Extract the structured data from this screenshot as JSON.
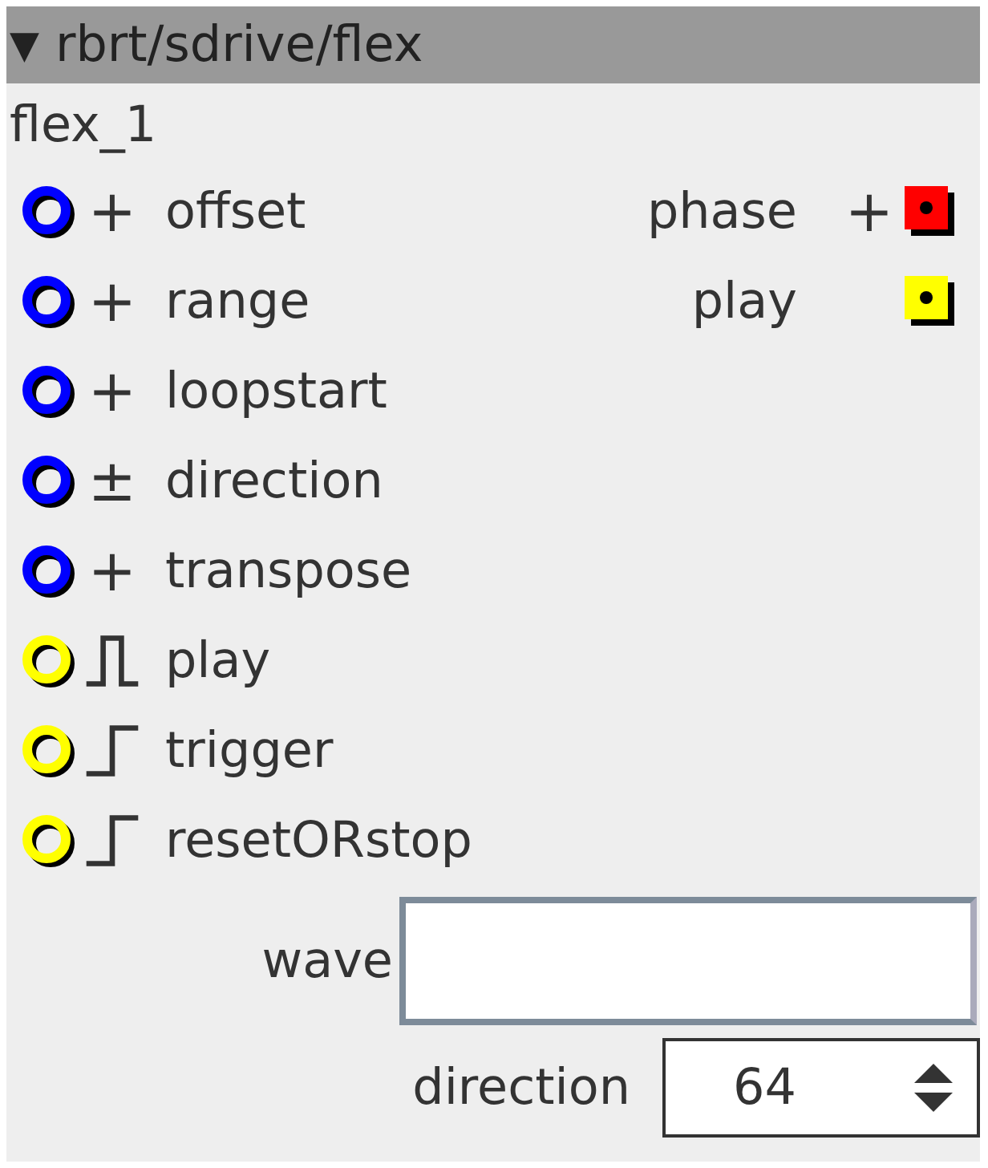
{
  "header": {
    "arrow": "▼",
    "title": "rbrt/sdrive/flex"
  },
  "node_name": "flex_1",
  "inputs": [
    {
      "name": "offset",
      "color": "#0000ff",
      "kind": "text",
      "symbol": "+"
    },
    {
      "name": "range",
      "color": "#0000ff",
      "kind": "text",
      "symbol": "+"
    },
    {
      "name": "loopstart",
      "color": "#0000ff",
      "kind": "text",
      "symbol": "+"
    },
    {
      "name": "direction",
      "color": "#0000ff",
      "kind": "text",
      "symbol": "±"
    },
    {
      "name": "transpose",
      "color": "#0000ff",
      "kind": "text",
      "symbol": "+"
    },
    {
      "name": "play",
      "color": "#ffff00",
      "kind": "pulse"
    },
    {
      "name": "trigger",
      "color": "#ffff00",
      "kind": "step"
    },
    {
      "name": "resetORstop",
      "color": "#ffff00",
      "kind": "step"
    }
  ],
  "outputs": [
    {
      "name": "phase",
      "color": "#ff0000",
      "symbol": "+"
    },
    {
      "name": "play",
      "color": "#ffff00"
    }
  ],
  "params": [
    {
      "kind": "text",
      "label": "wave"
    },
    {
      "kind": "spinner",
      "label": "direction",
      "value": "64"
    }
  ]
}
